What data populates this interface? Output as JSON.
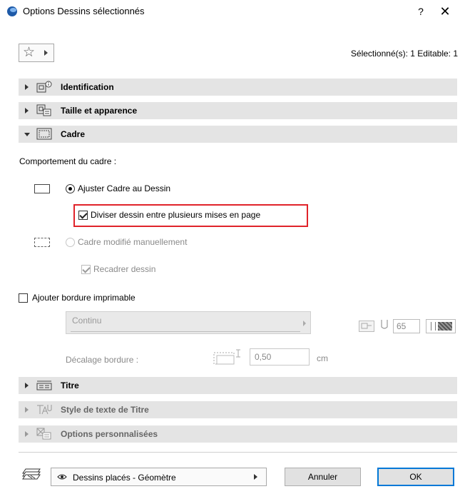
{
  "window": {
    "title": "Options Dessins sélectionnés",
    "help": "?",
    "close": "✕"
  },
  "toolbar": {
    "favorites_icon": "star-icon",
    "selection_info": "Sélectionné(s): 1 Editable: 1"
  },
  "panels": [
    {
      "label": "Identification",
      "icon": "identification-icon",
      "expanded": false,
      "enabled": true
    },
    {
      "label": "Taille et apparence",
      "icon": "size-appearance-icon",
      "expanded": false,
      "enabled": true
    },
    {
      "label": "Cadre",
      "icon": "frame-icon",
      "expanded": true,
      "enabled": true
    },
    {
      "label": "Titre",
      "icon": "title-icon",
      "expanded": false,
      "enabled": true
    },
    {
      "label": "Style de texte de Titre",
      "icon": "title-text-style-icon",
      "expanded": false,
      "enabled": false
    },
    {
      "label": "Options personnalisées",
      "icon": "custom-options-icon",
      "expanded": false,
      "enabled": false
    }
  ],
  "cadre": {
    "group_label": "Comportement du cadre :",
    "option_fit": "Ajuster Cadre au Dessin",
    "option_fit_selected": true,
    "split_label": "Diviser dessin entre plusieurs mises en page",
    "split_checked": true,
    "option_manual": "Cadre modifié manuellement",
    "option_manual_selected": false,
    "recrop_label": "Recadrer dessin",
    "recrop_checked": true,
    "add_border_label": "Ajouter bordure imprimable",
    "add_border_checked": false,
    "line_type": "Continu",
    "pen_value": "65",
    "offset_label": "Décalage bordure :",
    "offset_value": "0,50",
    "offset_unit": "cm"
  },
  "footer": {
    "layer_value": "Dessins placés - Géomètre",
    "cancel": "Annuler",
    "ok": "OK"
  },
  "colors": {
    "accent": "#0078d7",
    "highlight": "#e0232a",
    "panel_bar": "#e4e4e4"
  }
}
